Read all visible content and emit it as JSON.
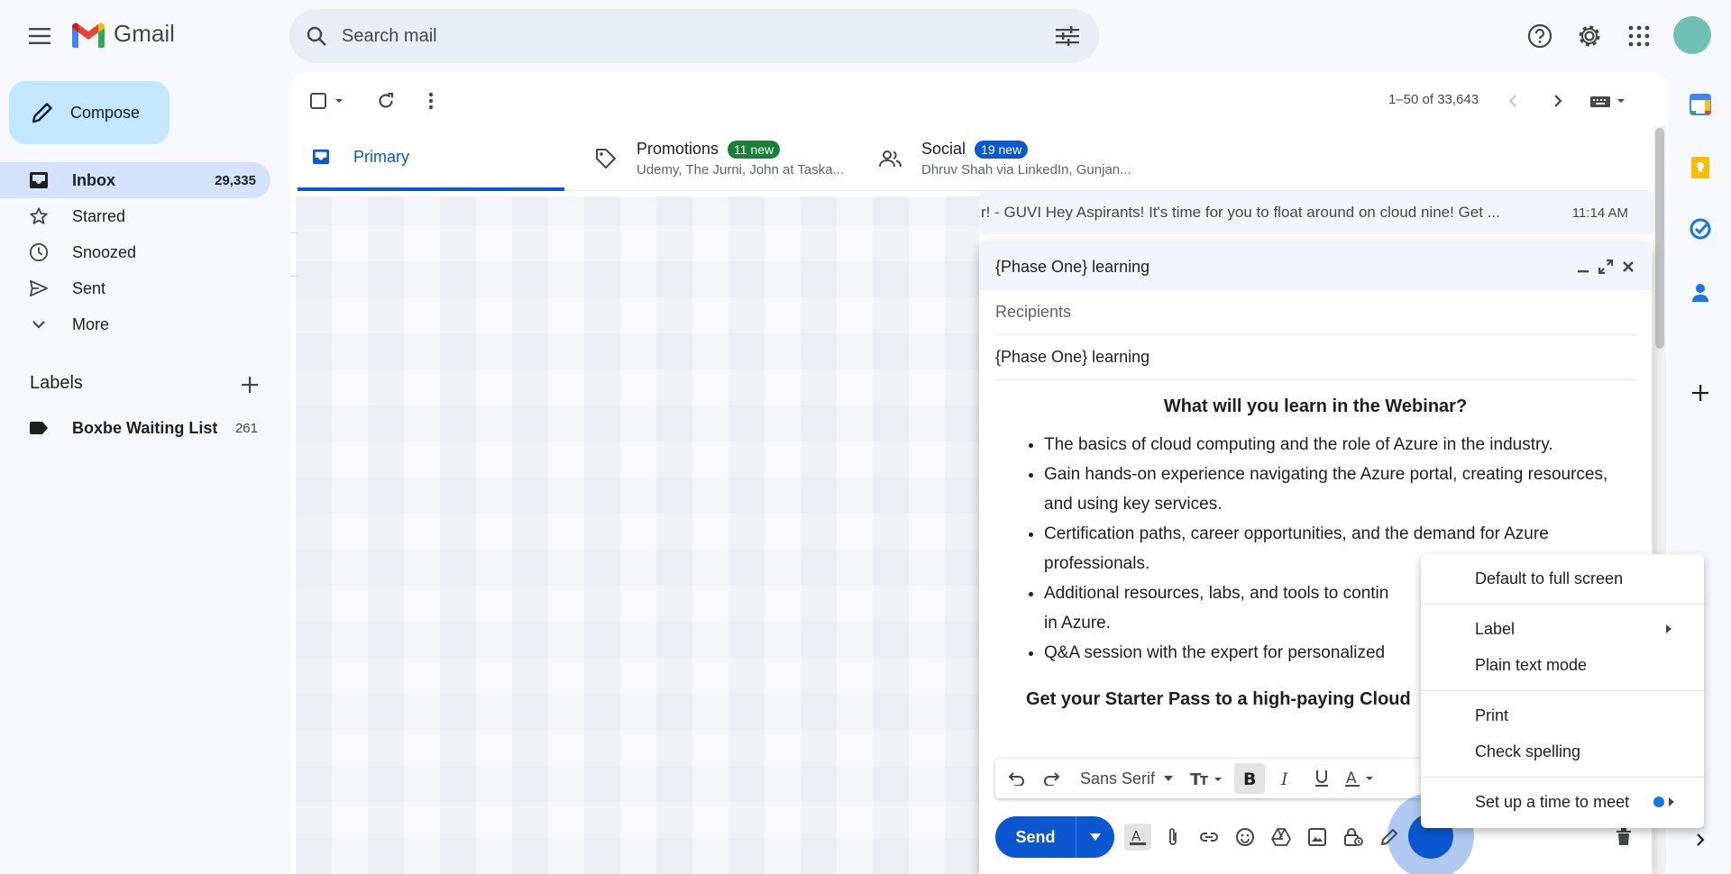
{
  "app": {
    "logo_text": "Gmail"
  },
  "search": {
    "placeholder": "Search mail"
  },
  "compose": {
    "label": "Compose"
  },
  "nav": {
    "items": [
      {
        "label": "Inbox",
        "count": "29,335"
      },
      {
        "label": "Starred",
        "count": ""
      },
      {
        "label": "Snoozed",
        "count": ""
      },
      {
        "label": "Sent",
        "count": ""
      },
      {
        "label": "More",
        "count": ""
      }
    ]
  },
  "labels": {
    "title": "Labels",
    "items": [
      {
        "label": "Boxbe Waiting List",
        "count": "261"
      }
    ]
  },
  "toolbar": {
    "pager": "1–50 of 33,643"
  },
  "tabs": {
    "primary": {
      "label": "Primary"
    },
    "promotions": {
      "label": "Promotions",
      "badge": "11 new",
      "sub": "Udemy, The Jurni, John at Taska...",
      "badge_color": "#188038"
    },
    "social": {
      "label": "Social",
      "badge": "19 new",
      "sub": "Dhruv Shah via LinkedIn, Gunjan...",
      "badge_color": "#0b57d0"
    }
  },
  "email_row": {
    "snippet": "r! - GUVI Hey Aspirants! It's time for you to float around on cloud nine! Get ...",
    "time": "11:14 AM"
  },
  "compose_window": {
    "title": "{Phase One} learning",
    "recipients_placeholder": "Recipients",
    "subject": "{Phase One} learning",
    "heading": "What will you learn in the Webinar?",
    "bullets": [
      "The basics of cloud computing and the role of Azure in the industry.",
      "Gain hands-on experience navigating the Azure portal, creating resources, and using key services.",
      "Certification paths, career opportunities, and the demand for Azure professionals.",
      "Additional resources, labs, and tools to contin",
      "Q&A session with the expert for personalized"
    ],
    "bullet4_line2": "in Azure.",
    "cta": "Get your Starter Pass to a high-paying Cloud",
    "font_name": "Sans Serif",
    "send_label": "Send"
  },
  "context_menu": {
    "items": [
      {
        "label": "Default to full screen"
      },
      {
        "label": "Label"
      },
      {
        "label": "Plain text mode"
      },
      {
        "label": "Print"
      },
      {
        "label": "Check spelling"
      },
      {
        "label": "Set up a time to meet"
      }
    ]
  },
  "colors": {
    "accent": "#0b57d0",
    "compose_bg": "#c2e7ff",
    "nav_active": "#d3e3fd",
    "avatar": "#6ec1b3"
  }
}
